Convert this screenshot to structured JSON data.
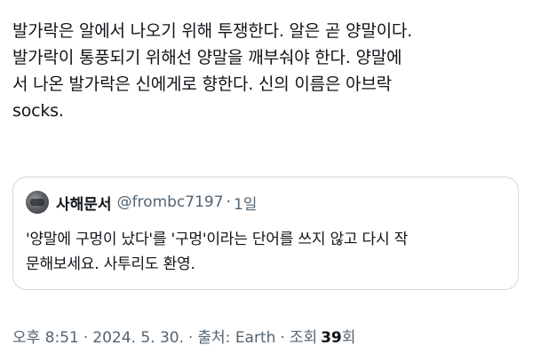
{
  "tweet": {
    "lines": [
      "발가락은 알에서 나오기 위해 투쟁한다. 알은 곧 양말이다.",
      "발가락이 통풍되기 위해선 양말을 깨부숴야 한다. 양말에",
      "서 나온 발가락은 신에게로 향한다. 신의 이름은 아브락",
      "socks."
    ]
  },
  "quote": {
    "avatar_icon": "user-avatar",
    "name": "사해문서",
    "handle": "@frombc7197",
    "separator": "·",
    "time": "1일",
    "lines": [
      "'양말에 구멍이 났다'를 '구멍'이라는 단어를 쓰지 않고 다시 작",
      "문해보세요. 사투리도 환영."
    ]
  },
  "meta": {
    "time": "오후 8:51",
    "separator": "·",
    "date": "2024. 5. 30.",
    "source_label": "출처: Earth",
    "views_label": "조회",
    "views_count": "39",
    "views_unit": "회"
  },
  "colors": {
    "text": "#0f1419",
    "secondary": "#536471",
    "border": "#cfd9de"
  }
}
